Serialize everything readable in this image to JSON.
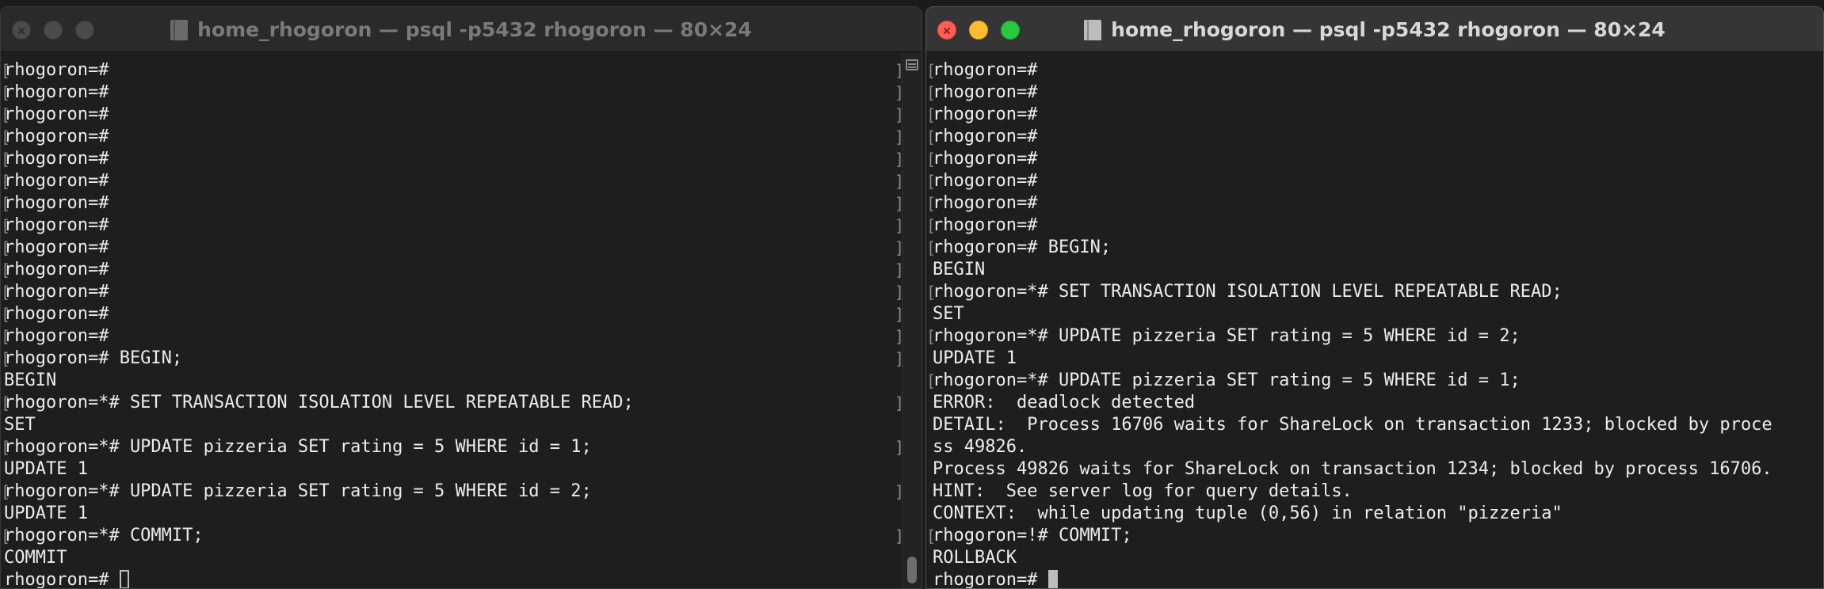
{
  "left_window": {
    "title": "home_rhogoron — psql -p5432 rhogoron — 80×24",
    "lines": [
      "rhogoron=#",
      "rhogoron=#",
      "rhogoron=#",
      "rhogoron=#",
      "rhogoron=#",
      "rhogoron=#",
      "rhogoron=#",
      "rhogoron=#",
      "rhogoron=#",
      "rhogoron=#",
      "rhogoron=#",
      "rhogoron=#",
      "rhogoron=#",
      "rhogoron=# BEGIN;",
      "BEGIN",
      "rhogoron=*# SET TRANSACTION ISOLATION LEVEL REPEATABLE READ;",
      "SET",
      "rhogoron=*# UPDATE pizzeria SET rating = 5 WHERE id = 1;",
      "UPDATE 1",
      "rhogoron=*# UPDATE pizzeria SET rating = 5 WHERE id = 2;",
      "UPDATE 1",
      "rhogoron=*# COMMIT;",
      "COMMIT",
      "rhogoron=# "
    ]
  },
  "right_window": {
    "title": "home_rhogoron — psql -p5432 rhogoron — 80×24",
    "lines": [
      "rhogoron=#",
      "rhogoron=#",
      "rhogoron=#",
      "rhogoron=#",
      "rhogoron=#",
      "rhogoron=#",
      "rhogoron=#",
      "rhogoron=#",
      "rhogoron=# BEGIN;",
      "BEGIN",
      "rhogoron=*# SET TRANSACTION ISOLATION LEVEL REPEATABLE READ;",
      "SET",
      "rhogoron=*# UPDATE pizzeria SET rating = 5 WHERE id = 2;",
      "UPDATE 1",
      "rhogoron=*# UPDATE pizzeria SET rating = 5 WHERE id = 1;",
      "ERROR:  deadlock detected",
      "DETAIL:  Process 16706 waits for ShareLock on transaction 1233; blocked by proce",
      "ss 49826.",
      "Process 49826 waits for ShareLock on transaction 1234; blocked by process 16706.",
      "HINT:  See server log for query details.",
      "CONTEXT:  while updating tuple (0,56) in relation \"pizzeria\"",
      "rhogoron=!# COMMIT;",
      "ROLLBACK",
      "rhogoron=# "
    ]
  },
  "colors": {
    "terminal_bg": "#1e1e1e",
    "terminal_fg": "#ececec",
    "close": "#ff5f57",
    "minimize": "#febc2e",
    "zoom": "#28c840"
  }
}
